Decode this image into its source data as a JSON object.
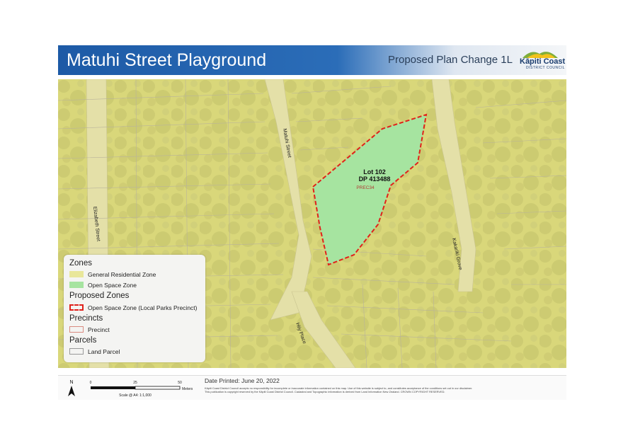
{
  "header": {
    "title": "Matuhi Street Playground",
    "subtitle": "Proposed Plan Change 1L",
    "logo_name": "Kāpiti Coast",
    "logo_sub": "DISTRICT COUNCIL"
  },
  "map": {
    "streets": [
      "Matuhi Street",
      "Elizabeth Street",
      "Kakariki Grove",
      "Hiiy Place"
    ],
    "lot_label_1": "Lot 102",
    "lot_label_2": "DP 413488",
    "precinct_label": "PREC34",
    "colors": {
      "residential_zone": "#d9d77a",
      "open_space_zone": "#a6e4a0",
      "proposed_boundary": "#e0221b",
      "parcel_line": "#b9b39b"
    }
  },
  "legend": {
    "zones_heading": "Zones",
    "general_residential": "General Residential Zone",
    "open_space": "Open Space Zone",
    "proposed_heading": "Proposed Zones",
    "proposed_open_space": "Open Space Zone (Local Parks Precinct)",
    "precincts_heading": "Precincts",
    "precinct": "Precinct",
    "parcels_heading": "Parcels",
    "land_parcel": "Land Parcel"
  },
  "footer": {
    "north": "N",
    "scale_0": "0",
    "scale_25": "25",
    "scale_50": "50",
    "scale_unit": "Meters",
    "scale_text": "Scale @ A4: 1:1,000",
    "date_printed": "Date Printed: June 20, 2022",
    "disclaimer_1": "Kāpiti Coast District Council accepts no responsibility for incomplete or inaccurate information contained on this map. Use of this website is subject to, and constitutes acceptance of the conditions set out in our disclaimer.",
    "disclaimer_2": "This publication is copyright reserved by the Kāpiti Coast District Council. Cadastral and Topographic information is derived from Land Information New Zealand. CROWN COPYRIGHT RESERVED."
  }
}
